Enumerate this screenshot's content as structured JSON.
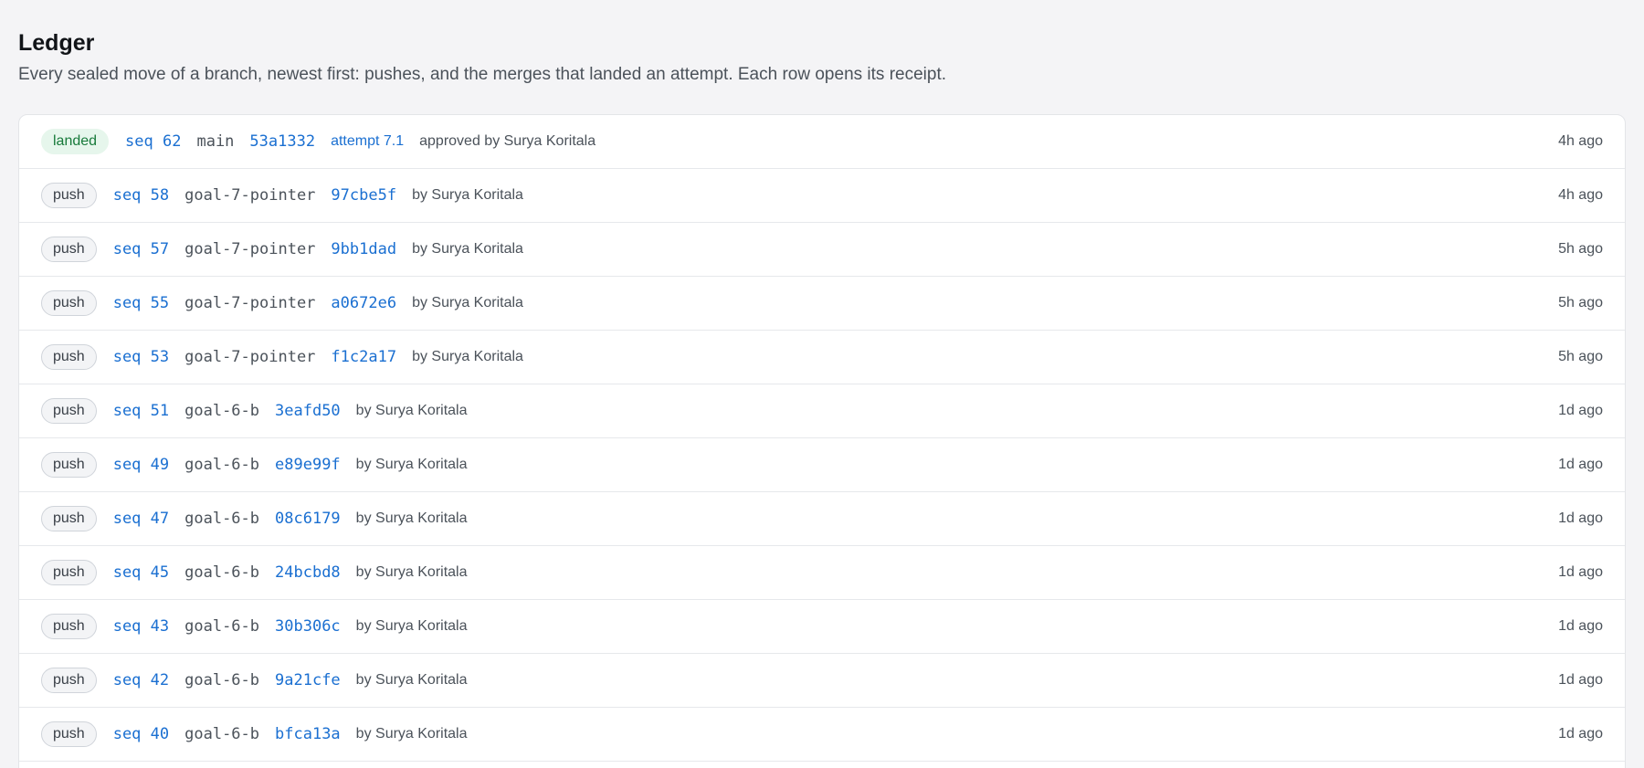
{
  "header": {
    "title": "Ledger",
    "subtitle": "Every sealed move of a branch, newest first: pushes, and the merges that landed an attempt. Each row opens its receipt."
  },
  "colors": {
    "link": "#1a6fd1",
    "landed_bg": "#e6f6ec",
    "landed_text": "#177a3a",
    "push_bg": "#f3f4f6"
  },
  "rows": [
    {
      "kind": "landed",
      "seq": "seq 62",
      "branch": "main",
      "sha": "53a1332",
      "attempt": "attempt 7.1",
      "meta": "approved by Surya Koritala",
      "time": "4h ago"
    },
    {
      "kind": "push",
      "seq": "seq 58",
      "branch": "goal-7-pointer",
      "sha": "97cbe5f",
      "attempt": "",
      "meta": "by Surya Koritala",
      "time": "4h ago"
    },
    {
      "kind": "push",
      "seq": "seq 57",
      "branch": "goal-7-pointer",
      "sha": "9bb1dad",
      "attempt": "",
      "meta": "by Surya Koritala",
      "time": "5h ago"
    },
    {
      "kind": "push",
      "seq": "seq 55",
      "branch": "goal-7-pointer",
      "sha": "a0672e6",
      "attempt": "",
      "meta": "by Surya Koritala",
      "time": "5h ago"
    },
    {
      "kind": "push",
      "seq": "seq 53",
      "branch": "goal-7-pointer",
      "sha": "f1c2a17",
      "attempt": "",
      "meta": "by Surya Koritala",
      "time": "5h ago"
    },
    {
      "kind": "push",
      "seq": "seq 51",
      "branch": "goal-6-b",
      "sha": "3eafd50",
      "attempt": "",
      "meta": "by Surya Koritala",
      "time": "1d ago"
    },
    {
      "kind": "push",
      "seq": "seq 49",
      "branch": "goal-6-b",
      "sha": "e89e99f",
      "attempt": "",
      "meta": "by Surya Koritala",
      "time": "1d ago"
    },
    {
      "kind": "push",
      "seq": "seq 47",
      "branch": "goal-6-b",
      "sha": "08c6179",
      "attempt": "",
      "meta": "by Surya Koritala",
      "time": "1d ago"
    },
    {
      "kind": "push",
      "seq": "seq 45",
      "branch": "goal-6-b",
      "sha": "24bcbd8",
      "attempt": "",
      "meta": "by Surya Koritala",
      "time": "1d ago"
    },
    {
      "kind": "push",
      "seq": "seq 43",
      "branch": "goal-6-b",
      "sha": "30b306c",
      "attempt": "",
      "meta": "by Surya Koritala",
      "time": "1d ago"
    },
    {
      "kind": "push",
      "seq": "seq 42",
      "branch": "goal-6-b",
      "sha": "9a21cfe",
      "attempt": "",
      "meta": "by Surya Koritala",
      "time": "1d ago"
    },
    {
      "kind": "push",
      "seq": "seq 40",
      "branch": "goal-6-b",
      "sha": "bfca13a",
      "attempt": "",
      "meta": "by Surya Koritala",
      "time": "1d ago"
    }
  ]
}
